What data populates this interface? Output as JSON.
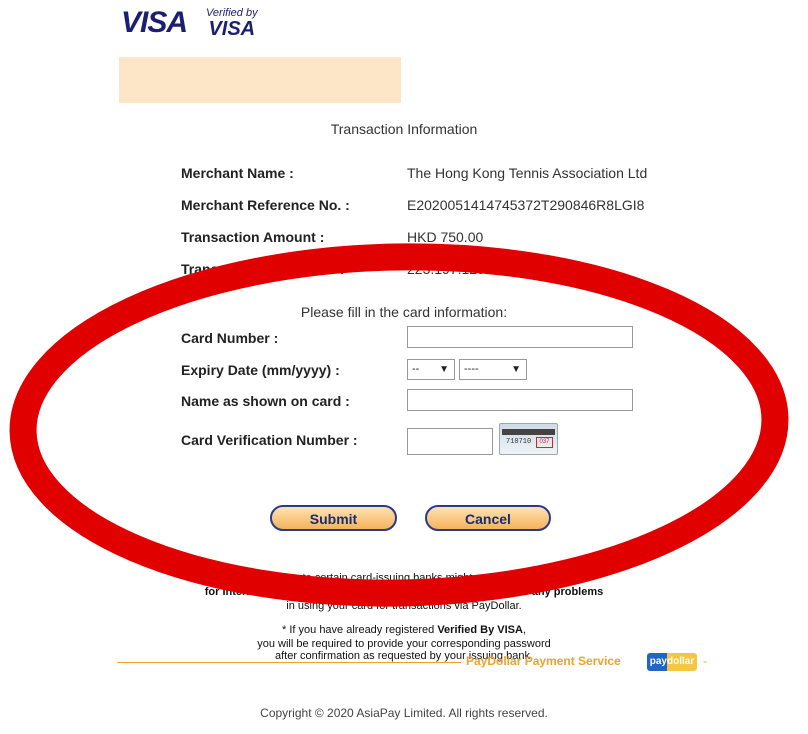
{
  "header": {
    "visa_logo": "VISA",
    "vbv_line1": "Verified by",
    "vbv_line2": "VISA"
  },
  "transaction": {
    "title": "Transaction Information",
    "rows": [
      {
        "label": "Merchant Name :",
        "value": "The Hong Kong Tennis Association Ltd"
      },
      {
        "label": "Merchant Reference No. :",
        "value": "E2020051414745372T290846R8LGI8"
      },
      {
        "label": "Transaction Amount :",
        "value": "HKD 750.00"
      },
      {
        "label": "Transaction IP Address :",
        "value": "223.197.129.182"
      }
    ]
  },
  "card_form": {
    "title": "Please fill in the card information:",
    "card_number_label": "Card Number :",
    "card_number_value": "",
    "expiry_label": "Expiry Date (mm/yyyy) :",
    "expiry_month": "--",
    "expiry_year": "----",
    "name_label": "Name as shown on card :",
    "name_value": "",
    "cvv_label": "Card Verification Number :",
    "cvv_value": "",
    "cvv_image_digits": "710710",
    "cvv_image_box": "037",
    "submit_label": "Submit",
    "cancel_label": "Cancel"
  },
  "notice": {
    "line1": "Please note certain card-issuing banks might not yet be ready",
    "line2": "for Internet transactions, please contact your issuing bank for any problems",
    "line3": "in using your card for transactions via PayDollar.",
    "vbv_line1_prefix": "* If you have already registered ",
    "vbv_line1_bold": "Verified By VISA",
    "vbv_line1_suffix": ",",
    "vbv_line2": "you will be required to provide your corresponding password",
    "vbv_line3": "after confirmation as requested by your issuing bank."
  },
  "footer": {
    "service": "PayDollar Payment Service",
    "logo_text": "paydollar",
    "dash": "-",
    "copyright": "Copyright © 2020 AsiaPay Limited. All rights reserved."
  },
  "colors": {
    "overlay_ring": "#e00000",
    "accent": "#f0a030",
    "brand": "#1a1f71"
  }
}
